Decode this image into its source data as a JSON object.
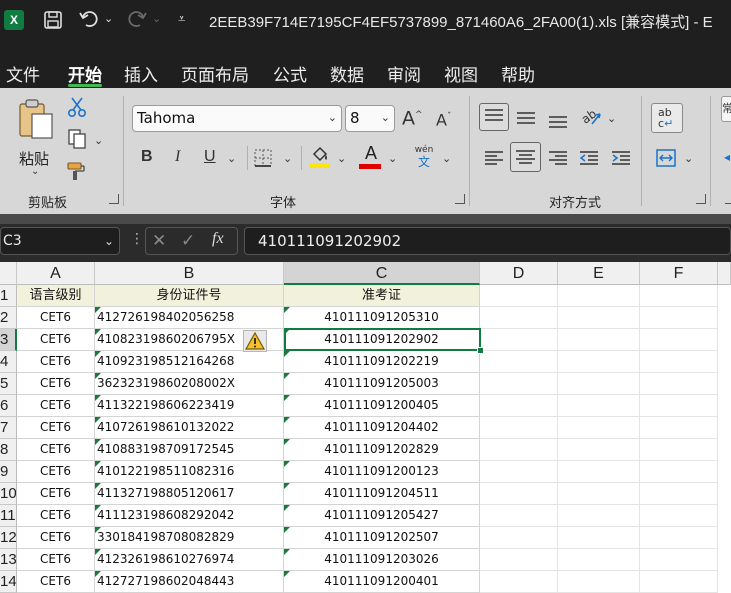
{
  "title": {
    "app_icon": "X",
    "text": "2EEB39F714E7195CF4EF5737899_871460A6_2FA00(1).xls  [兼容模式]  -  E"
  },
  "qat": {
    "save_icon": "save-icon",
    "undo_icon": "undo-icon",
    "redo_icon": "redo-icon",
    "customize_icon": "customize-qat-icon"
  },
  "tabs": [
    "文件",
    "开始",
    "插入",
    "页面布局",
    "公式",
    "数据",
    "审阅",
    "视图",
    "帮助"
  ],
  "ribbon": {
    "clipboard": {
      "paste_label": "粘贴",
      "group_label": "剪贴板"
    },
    "font": {
      "font_name": "Tahoma",
      "font_size": "8",
      "group_label": "字体",
      "bold": "B",
      "italic": "I",
      "underline": "U",
      "font_color_letter": "A",
      "phonetic_top": "wén",
      "phonetic_bottom": "文",
      "grow": "A",
      "shrink": "A"
    },
    "alignment": {
      "group_label": "对齐方式",
      "wrap_top": "ab",
      "wrap_bottom": "c"
    },
    "number": {
      "partial_label": "常"
    }
  },
  "formula_bar": {
    "name_box": "C3",
    "fx_label": "fx",
    "formula": "410111091202902"
  },
  "columns": [
    "A",
    "B",
    "C",
    "D",
    "E",
    "F"
  ],
  "rows": [
    "1",
    "2",
    "3",
    "4",
    "5",
    "6",
    "7",
    "8",
    "9",
    "10",
    "11",
    "12",
    "13",
    "14"
  ],
  "table": {
    "header": [
      "语言级别",
      "身份证件号",
      "准考证"
    ],
    "data": [
      [
        "CET6",
        "412726198402056258",
        "410111091205310"
      ],
      [
        "CET6",
        "41082319860206795X",
        "410111091202902"
      ],
      [
        "CET6",
        "410923198512164268",
        "410111091202219"
      ],
      [
        "CET6",
        "36232319860208002X",
        "410111091205003"
      ],
      [
        "CET6",
        "411322198606223419",
        "410111091200405"
      ],
      [
        "CET6",
        "410726198610132022",
        "410111091204402"
      ],
      [
        "CET6",
        "410883198709172545",
        "410111091202829"
      ],
      [
        "CET6",
        "410122198511082316",
        "410111091200123"
      ],
      [
        "CET6",
        "411327198805120617",
        "410111091204511"
      ],
      [
        "CET6",
        "411123198608292042",
        "410111091205427"
      ],
      [
        "CET6",
        "330184198708082829",
        "410111091202507"
      ],
      [
        "CET6",
        "412326198610276974",
        "410111091203026"
      ],
      [
        "CET6",
        "412727198602048443",
        "410111091200401"
      ]
    ]
  },
  "selected_cell": "C3",
  "colors": {
    "accent": "#107c41",
    "dark_chrome": "#1f1f1f",
    "ribbon": "#d7d7d7",
    "header_fill": "#f2f2dc"
  }
}
